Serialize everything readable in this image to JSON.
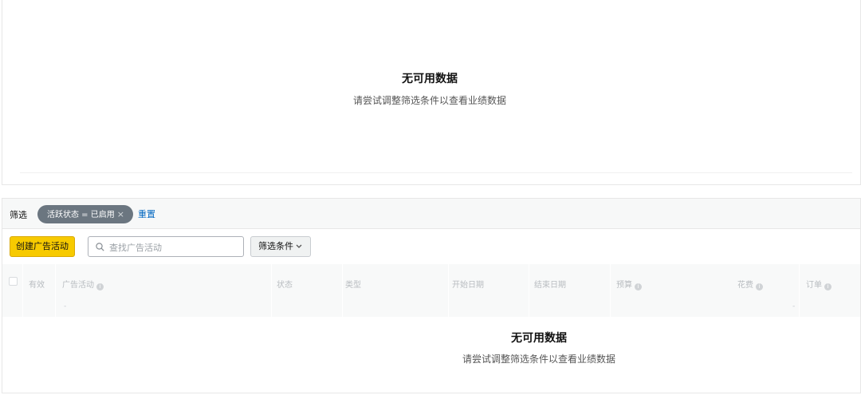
{
  "top_empty": {
    "title": "无可用数据",
    "subtitle": "请尝试调整筛选条件以查看业绩数据"
  },
  "filter_bar": {
    "label": "筛选",
    "chip_label": "活跃状态 = 已启用",
    "chip_close": "×",
    "reset_label": "重置"
  },
  "toolbar": {
    "create_label": "创建广告活动",
    "search_placeholder": "查找广告活动",
    "search_value": "",
    "filter_label": "筛选条件"
  },
  "table": {
    "columns": [
      {
        "label": "有效",
        "info": false
      },
      {
        "label": "广告活动",
        "info": true
      },
      {
        "label": "状态",
        "info": false
      },
      {
        "label": "类型",
        "info": false
      },
      {
        "label": "开始日期",
        "info": false
      },
      {
        "label": "结束日期",
        "info": false
      },
      {
        "label": "预算",
        "info": true
      },
      {
        "label": "花费",
        "info": true
      },
      {
        "label": "订单",
        "info": true
      }
    ],
    "summary_dash": "-"
  },
  "bottom_empty": {
    "title": "无可用数据",
    "subtitle": "请尝试调整筛选条件以查看业绩数据"
  },
  "colors": {
    "accent_button": "#f7ca00",
    "link": "#0066c0",
    "chip": "#6b7680"
  },
  "icons": [
    "search-icon",
    "chevron-down-icon",
    "close-icon",
    "info-icon"
  ]
}
